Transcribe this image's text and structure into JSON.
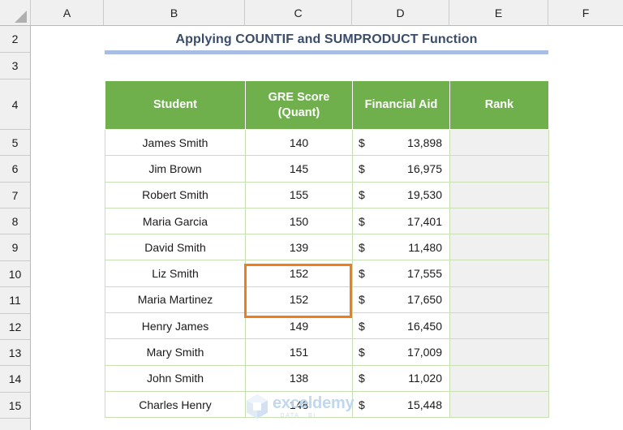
{
  "spreadsheet": {
    "column_headers": [
      "A",
      "B",
      "C",
      "D",
      "E",
      "F"
    ],
    "row_headers": [
      "2",
      "3",
      "4",
      "5",
      "6",
      "7",
      "8",
      "9",
      "10",
      "11",
      "12",
      "13",
      "14",
      "15"
    ],
    "select_all_icon": "select-all-corner-icon"
  },
  "title": {
    "text": "Applying COUNTIF and SUMPRODUCT Function",
    "color": "#3a4c6b",
    "rule_color": "#a7bde4"
  },
  "table": {
    "header_bg": "#6fb04d",
    "header_text_color": "#ffffff",
    "border_color": "#c6e0b4",
    "rank_cell_bg": "#f0f0f0",
    "columns": [
      {
        "label": "Student",
        "key": "student"
      },
      {
        "label": "GRE Score (Quant)",
        "line1": "GRE Score",
        "line2": "(Quant)",
        "key": "gre"
      },
      {
        "label": "Financial Aid",
        "key": "aid"
      },
      {
        "label": "Rank",
        "key": "rank"
      }
    ],
    "currency_symbol": "$",
    "rows": [
      {
        "student": "James Smith",
        "gre": "140",
        "aid": "13,898",
        "rank": ""
      },
      {
        "student": "Jim Brown",
        "gre": "145",
        "aid": "16,975",
        "rank": ""
      },
      {
        "student": "Robert Smith",
        "gre": "155",
        "aid": "19,530",
        "rank": ""
      },
      {
        "student": "Maria Garcia",
        "gre": "150",
        "aid": "17,401",
        "rank": ""
      },
      {
        "student": "David Smith",
        "gre": "139",
        "aid": "11,480",
        "rank": ""
      },
      {
        "student": "Liz Smith",
        "gre": "152",
        "aid": "17,555",
        "rank": ""
      },
      {
        "student": "Maria Martinez",
        "gre": "152",
        "aid": "17,650",
        "rank": ""
      },
      {
        "student": "Henry James",
        "gre": "149",
        "aid": "16,450",
        "rank": ""
      },
      {
        "student": "Mary Smith",
        "gre": "151",
        "aid": "17,009",
        "rank": ""
      },
      {
        "student": "John Smith",
        "gre": "138",
        "aid": "11,020",
        "rank": ""
      },
      {
        "student": "Charles Henry",
        "gre": "148",
        "aid": "15,448",
        "rank": ""
      }
    ]
  },
  "selection": {
    "range": "C10:C11",
    "color": "#ef7d1a"
  },
  "watermark": {
    "name": "exceldemy",
    "subtitle": "· DATA · BI",
    "color": "#bcd6ef"
  }
}
